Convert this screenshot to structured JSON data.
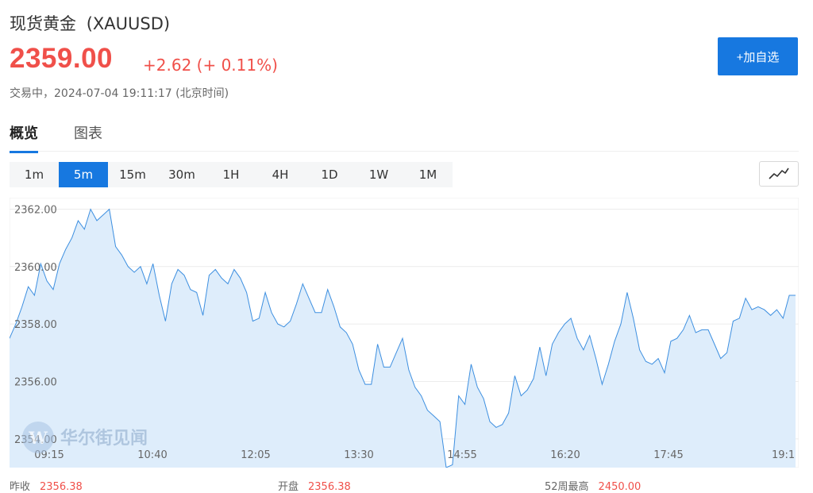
{
  "quote": {
    "name": "现货黄金",
    "symbol": "(XAUUSD)",
    "price": "2359.00",
    "change": "+2.62 (+ 0.11%)",
    "status": "交易中，2024-07-04 19:11:17 (北京时间)"
  },
  "watchlist_button": "+加自选",
  "tabs": [
    {
      "label": "概览",
      "active": true
    },
    {
      "label": "图表",
      "active": false
    }
  ],
  "intervals": [
    {
      "label": "1m",
      "active": false
    },
    {
      "label": "5m",
      "active": true
    },
    {
      "label": "15m",
      "active": false
    },
    {
      "label": "30m",
      "active": false
    },
    {
      "label": "1H",
      "active": false
    },
    {
      "label": "4H",
      "active": false
    },
    {
      "label": "1D",
      "active": false
    },
    {
      "label": "1W",
      "active": false
    },
    {
      "label": "1M",
      "active": false
    }
  ],
  "chart_toggle_icon": "line-chart-icon",
  "watermark": "华尔街见闻",
  "stats": [
    {
      "label": "昨收",
      "value": "2356.38"
    },
    {
      "label": "开盘",
      "value": "2356.38"
    },
    {
      "label": "52周最高",
      "value": "2450.00"
    }
  ],
  "colors": {
    "accent": "#1778e0",
    "up": "#f0504a",
    "line": "#3d8fe0",
    "area": "#deedfb"
  },
  "chart_data": {
    "type": "area",
    "title": "",
    "xlabel": "",
    "ylabel": "",
    "ylim": [
      2353.0,
      2362.4
    ],
    "yticks": [
      2354.0,
      2356.0,
      2358.0,
      2360.0,
      2362.0
    ],
    "ytick_labels": [
      "2354.00",
      "2356.00",
      "2358.00",
      "2360.00",
      "2362.00"
    ],
    "xtick_labels": [
      "09:15",
      "10:40",
      "12:05",
      "13:30",
      "14:55",
      "16:20",
      "17:45",
      "19:1"
    ],
    "grid": true,
    "series": [
      {
        "values": [
          2357.5,
          2358.0,
          2358.6,
          2359.3,
          2359.0,
          2360.1,
          2359.5,
          2359.2,
          2360.1,
          2360.6,
          2361.0,
          2361.6,
          2361.3,
          2362.0,
          2361.6,
          2361.8,
          2362.0,
          2360.7,
          2360.4,
          2360.0,
          2359.8,
          2360.0,
          2359.4,
          2360.1,
          2359.0,
          2358.1,
          2359.4,
          2359.9,
          2359.7,
          2359.2,
          2359.1,
          2358.3,
          2359.7,
          2359.9,
          2359.6,
          2359.4,
          2359.9,
          2359.6,
          2359.1,
          2358.1,
          2358.2,
          2359.1,
          2358.4,
          2358.0,
          2357.9,
          2358.1,
          2358.7,
          2359.4,
          2358.9,
          2358.4,
          2358.4,
          2359.2,
          2358.6,
          2357.9,
          2357.7,
          2357.3,
          2356.4,
          2355.9,
          2355.9,
          2357.3,
          2356.5,
          2356.5,
          2357.0,
          2357.5,
          2356.4,
          2355.8,
          2355.5,
          2355.0,
          2354.8,
          2354.6,
          2353.0,
          2353.1,
          2355.5,
          2355.2,
          2356.6,
          2355.8,
          2355.4,
          2354.6,
          2354.4,
          2354.5,
          2354.9,
          2356.2,
          2355.5,
          2355.7,
          2356.1,
          2357.2,
          2356.2,
          2357.3,
          2357.7,
          2358.0,
          2358.2,
          2357.5,
          2357.1,
          2357.6,
          2356.8,
          2355.9,
          2356.6,
          2357.4,
          2358.0,
          2359.1,
          2358.2,
          2357.1,
          2356.7,
          2356.6,
          2356.8,
          2356.3,
          2357.4,
          2357.5,
          2357.8,
          2358.3,
          2357.7,
          2357.8,
          2357.8,
          2357.3,
          2356.8,
          2357.0,
          2358.1,
          2358.2,
          2358.9,
          2358.5,
          2358.6,
          2358.5,
          2358.3,
          2358.5,
          2358.2,
          2359.0,
          2359.0
        ]
      }
    ]
  }
}
